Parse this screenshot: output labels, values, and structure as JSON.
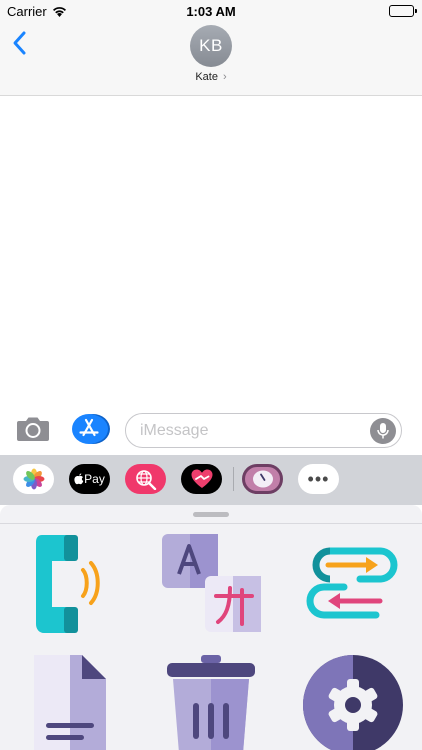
{
  "status_bar": {
    "carrier": "Carrier",
    "time": "1:03 AM"
  },
  "header": {
    "avatar_initials": "KB",
    "contact_name": "Kate",
    "name_chevron": "›"
  },
  "input_bar": {
    "placeholder": "iMessage"
  },
  "app_strip": {
    "apps": [
      {
        "name": "photos-app-icon"
      },
      {
        "name": "apple-pay-app",
        "label": "Pay"
      },
      {
        "name": "globe-search-app-icon"
      },
      {
        "name": "heart-app-icon"
      },
      {
        "name": "clock-app-icon",
        "selected": true
      },
      {
        "name": "more-apps",
        "label": "•••"
      }
    ]
  },
  "stickers": [
    "phone-call-sticker",
    "translate-sticker",
    "swap-arrows-sticker",
    "document-sticker",
    "trash-can-sticker",
    "settings-gear-sticker"
  ],
  "colors": {
    "ios_blue": "#1a84ff",
    "pay_black": "#000000",
    "globe_pink": "#f0386b",
    "sticker_teal": "#1cc5cf",
    "sticker_purple": "#9b92cc"
  }
}
